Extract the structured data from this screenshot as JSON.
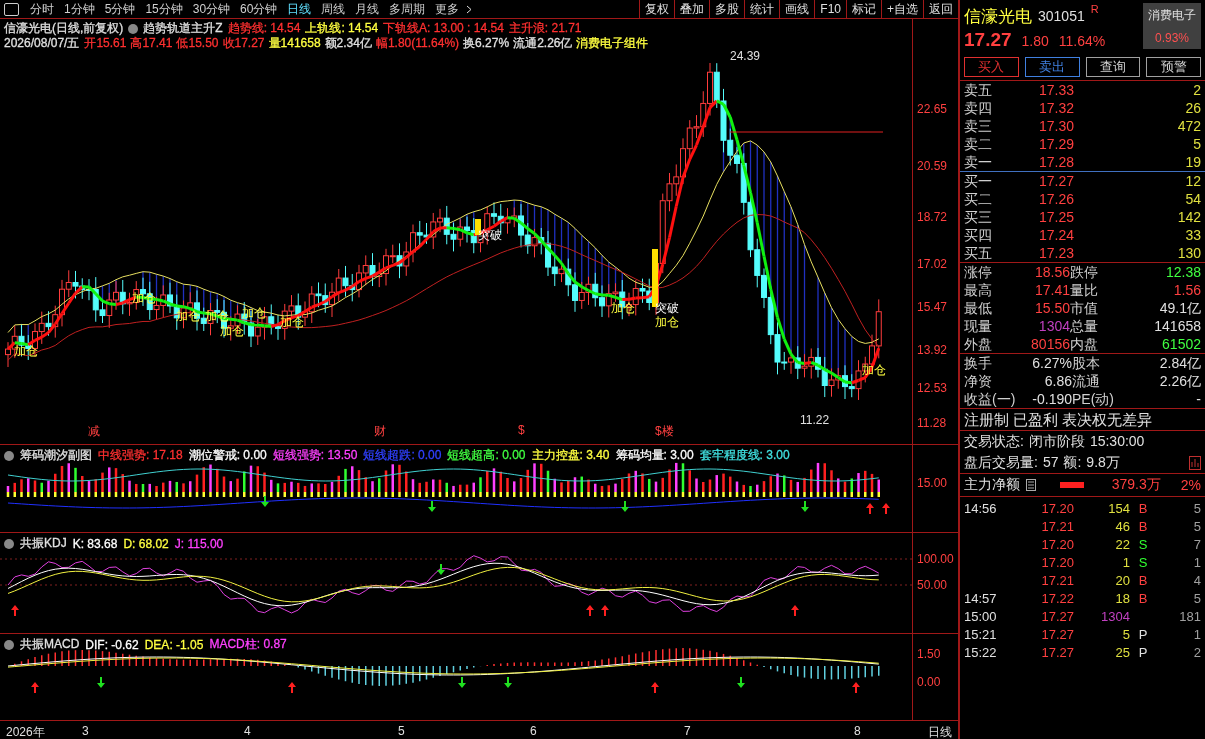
{
  "period_tabs": [
    {
      "label": "分时",
      "selected": false
    },
    {
      "label": "1分钟",
      "selected": false
    },
    {
      "label": "5分钟",
      "selected": false
    },
    {
      "label": "15分钟",
      "selected": false
    },
    {
      "label": "30分钟",
      "selected": false
    },
    {
      "label": "60分钟",
      "selected": false
    },
    {
      "label": "日线",
      "selected": true
    },
    {
      "label": "周线",
      "selected": false
    },
    {
      "label": "月线",
      "selected": false
    },
    {
      "label": "多周期",
      "selected": false
    },
    {
      "label": "更多",
      "selected": false
    }
  ],
  "toolbar": [
    "复权",
    "叠加",
    "多股",
    "统计",
    "画线",
    "F10",
    "标记",
    "+自选",
    "返回"
  ],
  "main_chart": {
    "title": "信濠光电(日线,前复权)",
    "formula": "趋势轨道主升Z",
    "params": [
      {
        "text": "趋势线: 14.54",
        "color": "#ff3030"
      },
      {
        "text": "上轨线: 14.54",
        "color": "#ffff40"
      },
      {
        "text": "下轨线A: 13.00 : 14.54",
        "color": "#ff3030"
      },
      {
        "text": "主升浪: 21.71",
        "color": "#ff3030"
      }
    ],
    "date": "2026/08/07/五",
    "quote": [
      {
        "text": "开15.61",
        "color": "#ff3030"
      },
      {
        "text": "高17.41",
        "color": "#ff3030"
      },
      {
        "text": "低15.50",
        "color": "#ff3030"
      },
      {
        "text": "收17.27",
        "color": "#ff3030"
      },
      {
        "text": "量141658",
        "color": "#ffff40"
      },
      {
        "text": "额2.34亿",
        "color": "#e0e0e0"
      },
      {
        "text": "幅1.80(11.64%)",
        "color": "#ff3030"
      },
      {
        "text": "换6.27%",
        "color": "#e0e0e0"
      },
      {
        "text": "流通2.26亿",
        "color": "#e0e0e0"
      },
      {
        "text": "消费电子组件",
        "color": "#ffff40"
      }
    ],
    "y_ticks": [
      "22.65",
      "20.59",
      "18.72",
      "17.02",
      "15.47",
      "13.92",
      "12.53",
      "11.28"
    ],
    "annotations": [
      {
        "text": "加仓",
        "kind": "add"
      },
      {
        "text": "加仓",
        "kind": "add"
      },
      {
        "text": "加仓",
        "kind": "add"
      },
      {
        "text": "加仓",
        "kind": "add"
      },
      {
        "text": "加仓",
        "kind": "add"
      },
      {
        "text": "加仓",
        "kind": "add"
      },
      {
        "text": "加仓",
        "kind": "add"
      },
      {
        "text": "加仓",
        "kind": "add"
      },
      {
        "text": "加仓",
        "kind": "add"
      },
      {
        "text": "加仓",
        "kind": "add"
      },
      {
        "text": "突破",
        "kind": "break"
      },
      {
        "text": "突破",
        "kind": "break"
      },
      {
        "text": "24.39",
        "kind": "extreme"
      },
      {
        "text": "11.22",
        "kind": "extreme"
      },
      {
        "text": "减",
        "kind": "event"
      },
      {
        "text": "财",
        "kind": "event"
      },
      {
        "text": "$",
        "kind": "event"
      },
      {
        "text": "$楼",
        "kind": "event"
      }
    ]
  },
  "chip_panel": {
    "title": "筹码潮汐副图",
    "params": [
      {
        "text": "中线强势: 17.18",
        "color": "#ff3030"
      },
      {
        "text": "潮位警戒: 0.00",
        "color": "#ffffff"
      },
      {
        "text": "短线强势: 13.50",
        "color": "#ff40ff"
      },
      {
        "text": "短线超跌: 0.00",
        "color": "#3040ff"
      },
      {
        "text": "短线超高: 0.00",
        "color": "#40ff40"
      },
      {
        "text": "主力控盘: 3.40",
        "color": "#ffff40"
      },
      {
        "text": "筹码均量: 3.00",
        "color": "#ffffff"
      },
      {
        "text": "套牢程度线: 3.00",
        "color": "#40e0e0"
      }
    ],
    "y_ticks": [
      "15.00"
    ]
  },
  "kdj_panel": {
    "title": "共振KDJ",
    "params": [
      {
        "text": "K: 83.68",
        "color": "#ffffff"
      },
      {
        "text": "D: 68.02",
        "color": "#ffff40"
      },
      {
        "text": "J: 115.00",
        "color": "#ff40ff"
      }
    ],
    "y_ticks": [
      "100.00",
      "50.00"
    ]
  },
  "macd_panel": {
    "title": "共振MACD",
    "params": [
      {
        "text": "DIF: -0.62",
        "color": "#ffffff"
      },
      {
        "text": "DEA: -1.05",
        "color": "#ffff40"
      },
      {
        "text": "MACD柱: 0.87",
        "color": "#ff40ff"
      }
    ],
    "y_ticks": [
      "1.50",
      "0.00"
    ]
  },
  "time_axis": [
    "2026年",
    "3",
    "4",
    "5",
    "6",
    "7",
    "8"
  ],
  "period_label": "日线",
  "stock": {
    "name": "信濠光电",
    "code": "301051",
    "badge": "R",
    "sector": "消费电子",
    "sector_change": "0.93%",
    "price": "17.27",
    "change": "1.80",
    "change_pct": "11.64%"
  },
  "actions": [
    {
      "label": "买入",
      "kind": "buy"
    },
    {
      "label": "卖出",
      "kind": "sell"
    },
    {
      "label": "查询",
      "kind": "plain"
    },
    {
      "label": "预警",
      "kind": "plain"
    }
  ],
  "asks": [
    {
      "label": "卖五",
      "price": "17.33",
      "volume": "2"
    },
    {
      "label": "卖四",
      "price": "17.32",
      "volume": "26"
    },
    {
      "label": "卖三",
      "price": "17.30",
      "volume": "472"
    },
    {
      "label": "卖二",
      "price": "17.29",
      "volume": "5"
    },
    {
      "label": "卖一",
      "price": "17.28",
      "volume": "19"
    }
  ],
  "bids": [
    {
      "label": "买一",
      "price": "17.27",
      "volume": "12"
    },
    {
      "label": "买二",
      "price": "17.26",
      "volume": "54"
    },
    {
      "label": "买三",
      "price": "17.25",
      "volume": "142"
    },
    {
      "label": "买四",
      "price": "17.24",
      "volume": "33"
    },
    {
      "label": "买五",
      "price": "17.23",
      "volume": "130"
    }
  ],
  "stats": [
    [
      {
        "label": "涨停",
        "value": "18.56",
        "color": "#ff4040"
      },
      {
        "label": "跌停",
        "value": "12.38",
        "color": "#40ff40"
      }
    ],
    [
      {
        "label": "最高",
        "value": "17.41",
        "color": "#ff4040"
      },
      {
        "label": "量比",
        "value": "1.56",
        "color": "#ff4040"
      }
    ],
    [
      {
        "label": "最低",
        "value": "15.50",
        "color": "#ff4040"
      },
      {
        "label": "市值",
        "value": "49.1亿",
        "color": "#e0e0e0"
      }
    ],
    [
      {
        "label": "现量",
        "value": "1304",
        "color": "#c040c0"
      },
      {
        "label": "总量",
        "value": "141658",
        "color": "#e0e0e0"
      }
    ],
    [
      {
        "label": "外盘",
        "value": "80156",
        "color": "#ff4040"
      },
      {
        "label": "内盘",
        "value": "61502",
        "color": "#40ff40"
      }
    ]
  ],
  "finance": [
    [
      {
        "label": "换手",
        "value": "6.27%"
      },
      {
        "label": "股本",
        "value": "2.84亿"
      }
    ],
    [
      {
        "label": "净资",
        "value": "6.86"
      },
      {
        "label": "流通",
        "value": "2.26亿"
      }
    ],
    [
      {
        "label": "收益(一)",
        "value": "-0.190"
      },
      {
        "label": "PE(动)",
        "value": "-"
      }
    ]
  ],
  "tags": "注册制 已盈利 表决权无差异",
  "trade_status": {
    "label": "交易状态:",
    "value": "闭市阶段",
    "time": "15:30:00"
  },
  "after_hours": {
    "volume_label": "盘后交易量:",
    "volume": "57",
    "amount_label": "额:",
    "amount": "9.8万"
  },
  "main_net": {
    "label": "主力净额",
    "value": "379.3万",
    "pct": "2%"
  },
  "ticks": [
    {
      "time": "14:56",
      "price": "17.20",
      "volume": "154",
      "side": "B",
      "color": "#ff4040",
      "count": "5",
      "kind": "normal"
    },
    {
      "price": "17.21",
      "volume": "46",
      "side": "B",
      "color": "#ff4040",
      "count": "5",
      "kind": "normal"
    },
    {
      "price": "17.20",
      "volume": "22",
      "side": "S",
      "color": "#30ff30",
      "count": "7",
      "kind": "normal"
    },
    {
      "price": "17.20",
      "volume": "1",
      "side": "S",
      "color": "#30ff30",
      "count": "1",
      "kind": "normal"
    },
    {
      "price": "17.21",
      "volume": "20",
      "side": "B",
      "color": "#ff4040",
      "count": "4",
      "kind": "normal"
    },
    {
      "time": "14:57",
      "price": "17.22",
      "volume": "18",
      "side": "B",
      "color": "#ff4040",
      "count": "5",
      "kind": "normal"
    },
    {
      "time": "15:00",
      "price": "17.27",
      "volume": "1304",
      "count": "181",
      "kind": "large"
    },
    {
      "time": "15:21",
      "price": "17.27",
      "volume": "5",
      "side": "P",
      "color": "#e0e0e0",
      "count": "1",
      "kind": "normal"
    },
    {
      "time": "15:22",
      "price": "17.27",
      "volume": "25",
      "side": "P",
      "color": "#e0e0e0",
      "count": "2",
      "kind": "normal"
    }
  ]
}
